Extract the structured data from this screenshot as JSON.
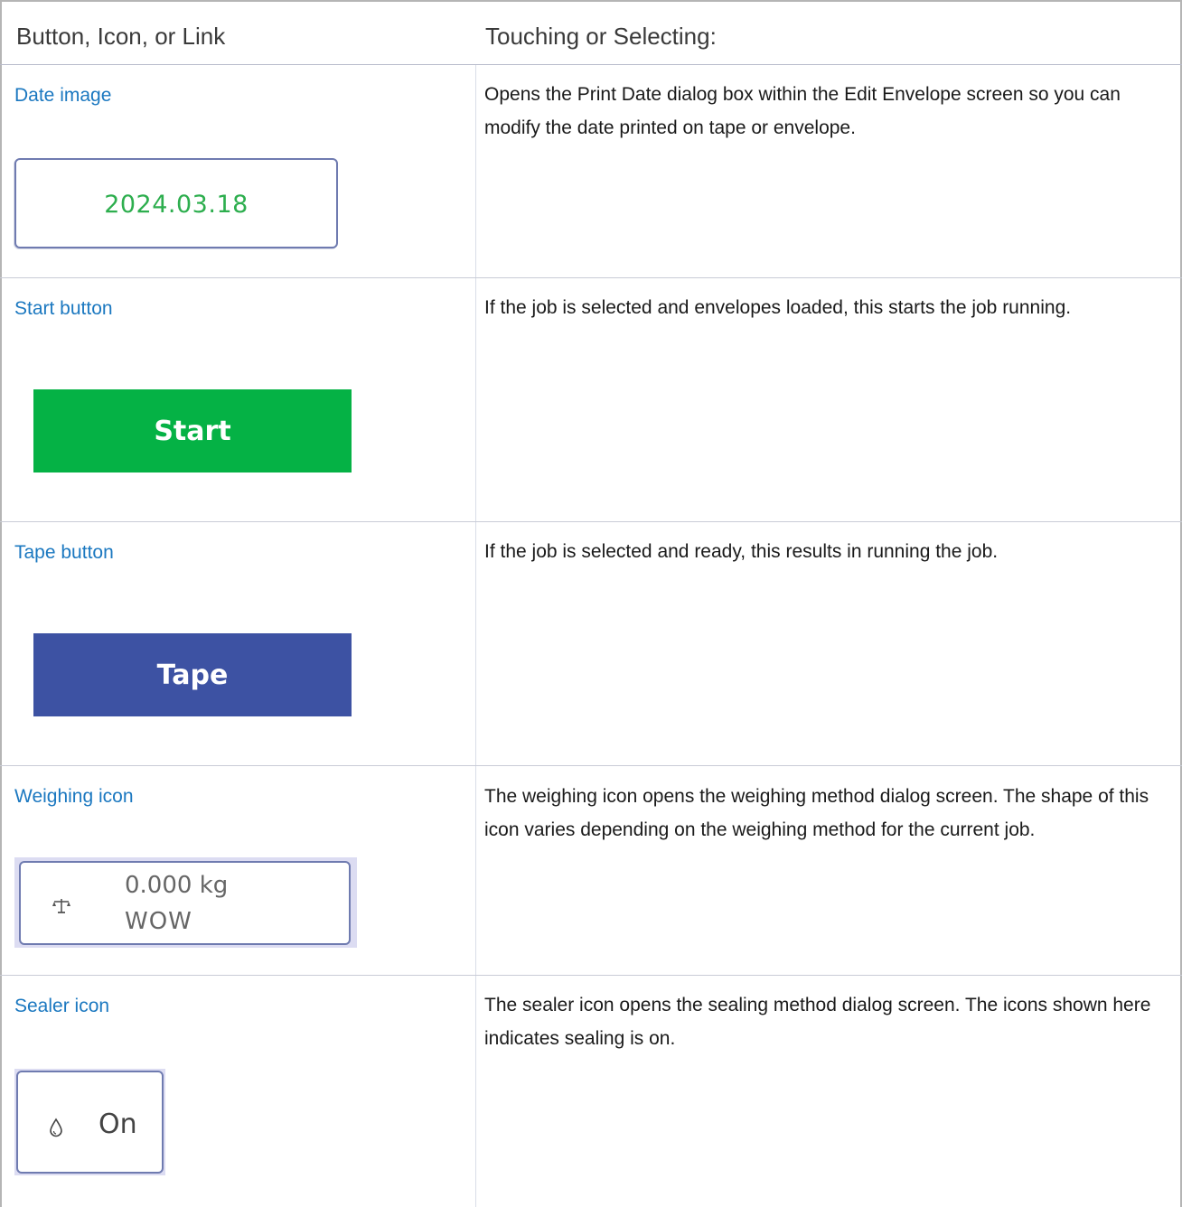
{
  "header": {
    "col1": "Button, Icon, or Link",
    "col2": "Touching or Selecting:"
  },
  "rows": [
    {
      "link": "Date image",
      "description": "Opens the Print Date dialog box within the Edit Envelope screen so you can modify the date printed on tape or envelope.",
      "widget_text": "2024.03.18"
    },
    {
      "link": "Start button",
      "description": "If the job is selected and envelopes loaded, this starts the job running.",
      "widget_text": "Start"
    },
    {
      "link": "Tape button",
      "description": "If the job is selected and ready, this results in running the job.",
      "widget_text": "Tape"
    },
    {
      "link": "Weighing icon",
      "description": "The weighing icon opens the weighing method dialog screen. The shape of this icon varies depending on the weighing method for the current job.",
      "widget_line1": "0.000 kg",
      "widget_line2": "WOW",
      "icon": "scale-icon"
    },
    {
      "link": "Sealer icon",
      "description": "The sealer icon opens the sealing method dialog screen. The icons shown here indicates sealing is on.",
      "widget_text": "On",
      "icon": "water-drop-icon"
    }
  ],
  "colors": {
    "link": "#1b78c0",
    "start_green": "#05b245",
    "tape_blue": "#3d52a3",
    "date_green": "#2dae4e"
  }
}
